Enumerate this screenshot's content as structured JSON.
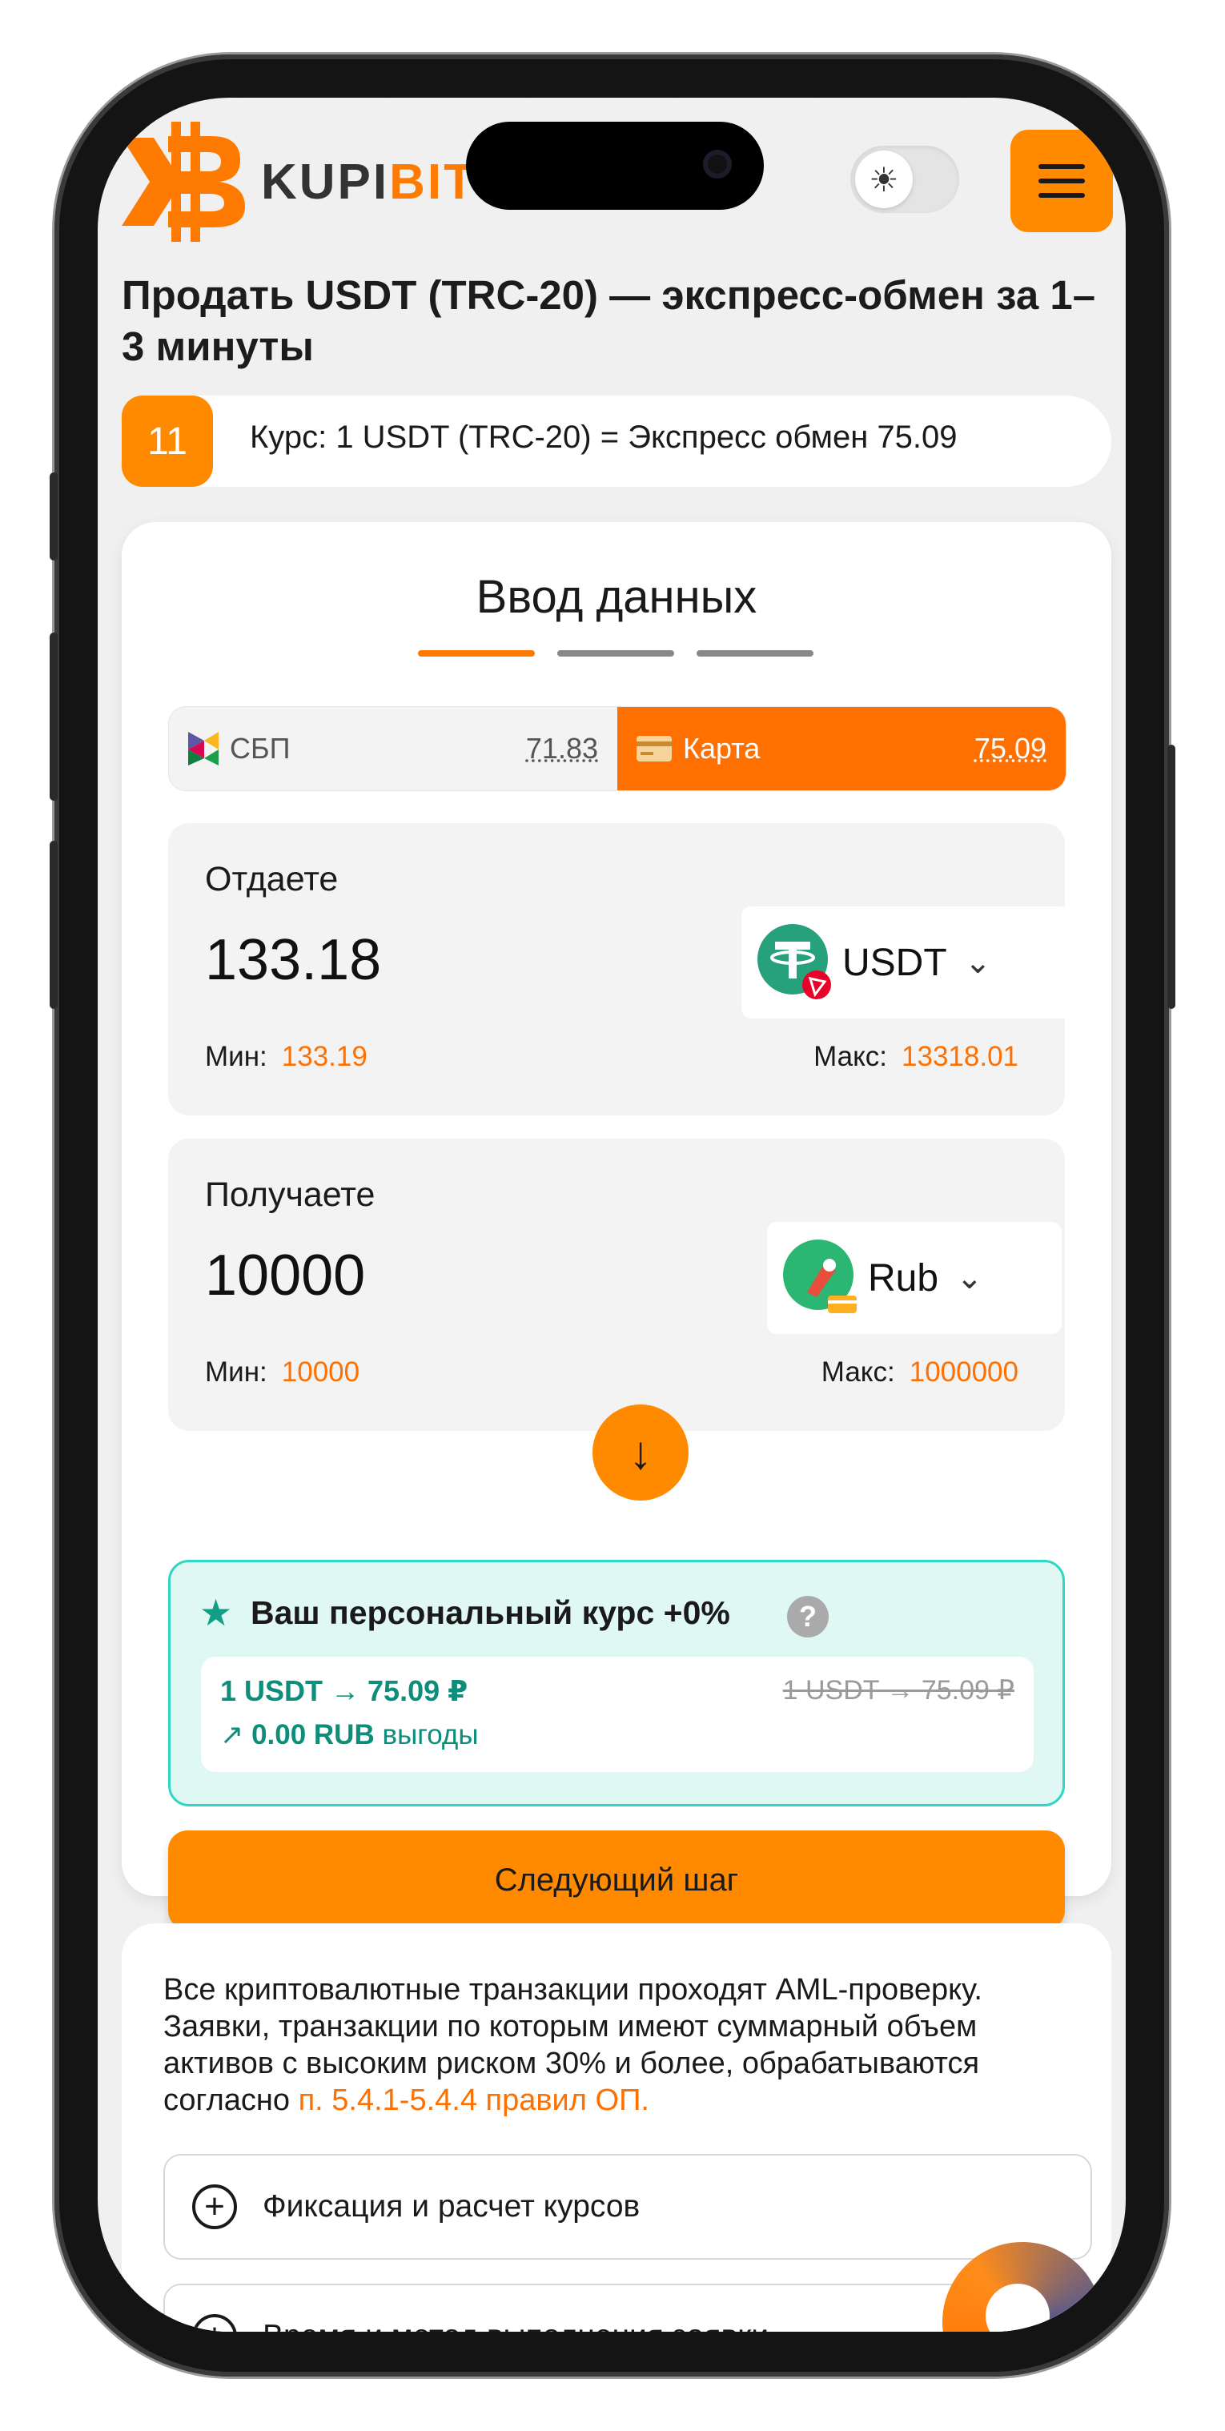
{
  "header": {
    "logo_text_main": "KUPI",
    "logo_text_accent": "BIT",
    "theme_toggle_icon": "sun-icon",
    "menu_icon": "hamburger-icon"
  },
  "page_title": "Продать USDT (TRC-20) — экспресс-обмен за 1–3 минуты",
  "rate_bar": {
    "badge": "11",
    "text": "Курс: 1 USDT (TRC-20) = Экспресс обмен 75.09"
  },
  "card": {
    "title": "Ввод данных",
    "steps": [
      "active",
      "inactive",
      "inactive"
    ]
  },
  "payment_tabs": [
    {
      "label": "СБП",
      "rate": "71.83",
      "active": false
    },
    {
      "label": "Карта",
      "rate": "75.09",
      "active": true
    }
  ],
  "give": {
    "label": "Отдаете",
    "amount": "133.18",
    "currency": "USDT",
    "min_label": "Мин:",
    "min_value": "133.19",
    "max_label": "Макс:",
    "max_value": "13318.01"
  },
  "receive": {
    "label": "Получаете",
    "amount": "10000",
    "currency": "Rub",
    "min_label": "Мин:",
    "min_value": "10000",
    "max_label": "Макс:",
    "max_value": "1000000"
  },
  "personal_rate": {
    "title": "Ваш персональный курс +0%",
    "help": "?",
    "rate": "1 USDT → 75.09 ₽",
    "old_rate": "1 USDT → 75.09 ₽",
    "benefit_value": "0.00 RUB",
    "benefit_suffix": "выгоды"
  },
  "next_button": "Следующий шаг",
  "info": {
    "text": "Все криптовалютные транзакции проходят AML-проверку. Заявки, транзакции по которым имеют суммарный объем активов с высоким риском 30% и более, обрабатываются согласно ",
    "link": "п. 5.4.1-5.4.4 правил ОП."
  },
  "accordions": [
    {
      "label": "Фиксация и расчет курсов"
    },
    {
      "label": "Время и метод выполнения заявки"
    }
  ],
  "colors": {
    "accent": "#ff7a00",
    "teal": "#129e85"
  }
}
